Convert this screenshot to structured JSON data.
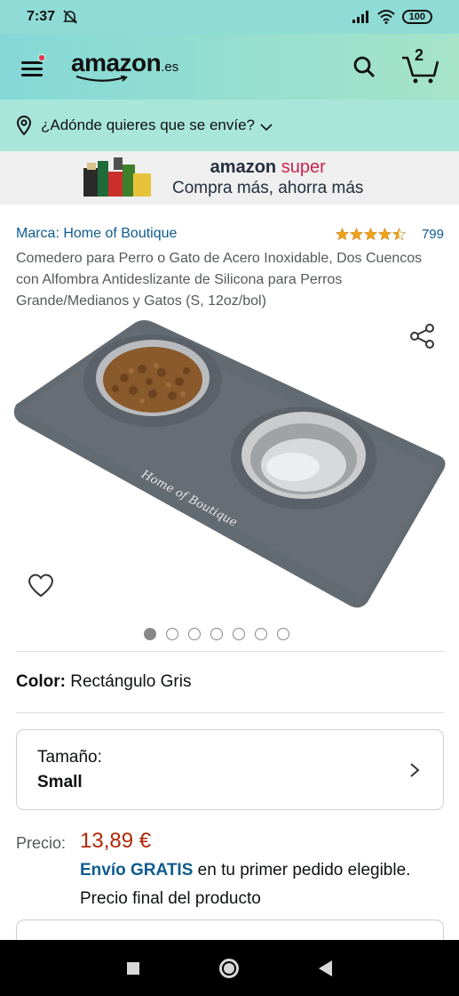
{
  "status_bar": {
    "time": "7:37",
    "battery": "100"
  },
  "header": {
    "logo": "amazon",
    "logo_tld": ".es",
    "cart_count": "2"
  },
  "location": {
    "text": "¿Adónde quieres que se envíe?"
  },
  "banner": {
    "brand": "amazon",
    "brand_suffix": "super",
    "tagline": "Compra más, ahorra más"
  },
  "product": {
    "brand_link": "Marca: Home of Boutique",
    "rating": 4.5,
    "rating_count": "799",
    "title": "Comedero para Perro o Gato de Acero Inoxidable, Dos Cuencos con Alfombra Antideslizante de Silicona para Perros Grande/Medianos y Gatos (S, 12oz/bol)",
    "image_label": "Home of Boutique",
    "image_count": 7,
    "active_image": 0
  },
  "color": {
    "label": "Color:",
    "value": "Rectángulo Gris"
  },
  "size": {
    "label": "Tamaño:",
    "value": "Small"
  },
  "price": {
    "label": "Precio:",
    "value": "13,89 €",
    "shipping_free": "Envío GRATIS",
    "shipping_rest": " en tu primer pedido elegible.",
    "final_note": "Precio final del producto"
  },
  "colors": {
    "accent_link": "#0e5b8f",
    "price": "#b12704",
    "header": "#8fdbd6",
    "star": "#f0a41a"
  }
}
